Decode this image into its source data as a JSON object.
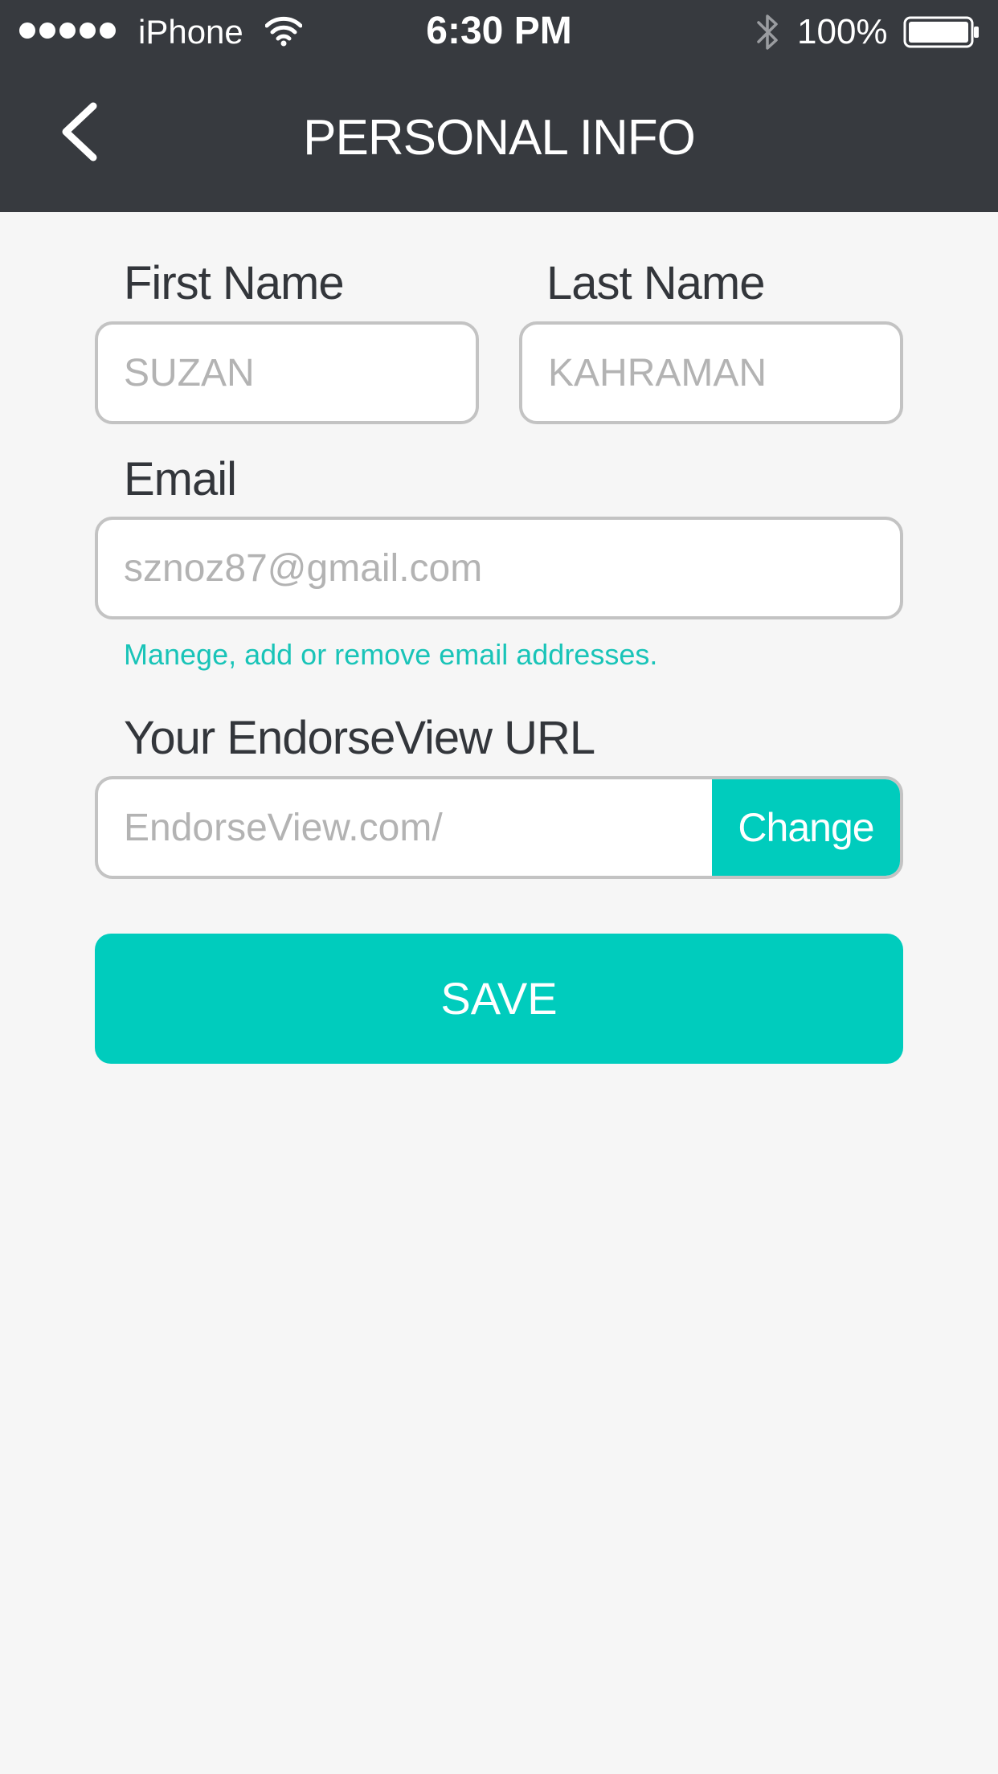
{
  "status_bar": {
    "carrier": "iPhone",
    "time": "6:30 PM",
    "battery": "100%",
    "signal_icon": "signal-dots-icon",
    "wifi_icon": "wifi-icon",
    "bluetooth_icon": "bluetooth-icon",
    "battery_icon": "battery-icon"
  },
  "nav": {
    "title": "PERSONAL INFO",
    "back_icon": "chevron-left-icon"
  },
  "form": {
    "first_name": {
      "label": "First Name",
      "placeholder": "SUZAN"
    },
    "last_name": {
      "label": "Last Name",
      "placeholder": "KAHRAMAN"
    },
    "email": {
      "label": "Email",
      "placeholder": "sznoz87@gmail.com",
      "helper": "Manege, add or remove email addresses."
    },
    "url": {
      "label": "Your EndorseView URL",
      "placeholder": "EndorseView.com/",
      "change_label": "Change"
    },
    "save_label": "SAVE"
  },
  "colors": {
    "header_bg": "#373a3f",
    "page_bg": "#f6f6f6",
    "accent": "#00ccbd",
    "label_text": "#33363b",
    "placeholder_text": "#b3b3b3",
    "input_border": "#c3c3c3"
  }
}
